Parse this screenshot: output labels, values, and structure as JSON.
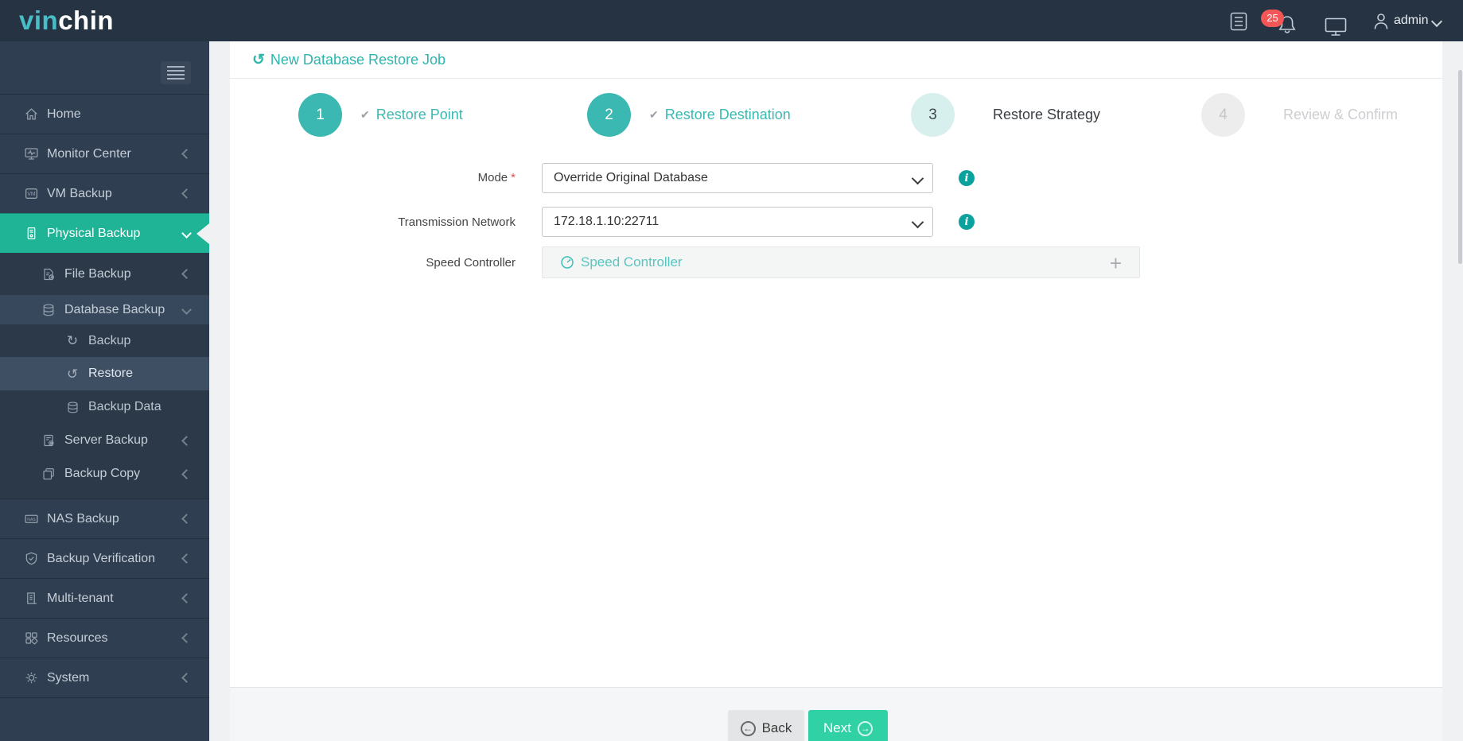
{
  "brand": {
    "accent": "vin",
    "rest": "chin"
  },
  "topbar": {
    "notification_count": "25",
    "username": "admin"
  },
  "sidebar": {
    "items": [
      {
        "label": "Home",
        "icon": "home-icon",
        "chevron": "none",
        "level": "main",
        "active": false
      },
      {
        "label": "Monitor Center",
        "icon": "monitor-center-icon",
        "chevron": "left",
        "level": "main",
        "active": false
      },
      {
        "label": "VM Backup",
        "icon": "vm-backup-icon",
        "chevron": "left",
        "level": "main",
        "active": false
      },
      {
        "label": "Physical Backup",
        "icon": "physical-backup-icon",
        "chevron": "down",
        "level": "main",
        "active": true
      },
      {
        "label": "File Backup",
        "icon": "file-backup-icon",
        "chevron": "left",
        "level": "sub1",
        "active": false
      },
      {
        "label": "Database Backup",
        "icon": "database-icon",
        "chevron": "down",
        "level": "sub1",
        "active": false,
        "expanded": true
      },
      {
        "label": "Backup",
        "icon": "backup-circular-arrow-icon",
        "glyph": "↻",
        "chevron": "none",
        "level": "sub2",
        "active": false
      },
      {
        "label": "Restore",
        "icon": "restore-circular-arrow-icon",
        "glyph": "↺",
        "chevron": "none",
        "level": "sub2",
        "active": false,
        "selected": true
      },
      {
        "label": "Backup Data",
        "icon": "database-icon",
        "chevron": "none",
        "level": "sub2",
        "active": false
      },
      {
        "label": "Server Backup",
        "icon": "server-backup-icon",
        "chevron": "left",
        "level": "sub1",
        "active": false
      },
      {
        "label": "Backup Copy",
        "icon": "backup-copy-icon",
        "chevron": "left",
        "level": "sub1",
        "active": false
      },
      {
        "label": "NAS Backup",
        "icon": "nas-backup-icon",
        "chevron": "left",
        "level": "main",
        "active": false
      },
      {
        "label": "Backup Verification",
        "icon": "shield-check-icon",
        "chevron": "left",
        "level": "main",
        "active": false
      },
      {
        "label": "Multi-tenant",
        "icon": "building-icon",
        "chevron": "left",
        "level": "main",
        "active": false
      },
      {
        "label": "Resources",
        "icon": "grid-icon",
        "chevron": "left",
        "level": "main",
        "active": false
      },
      {
        "label": "System",
        "icon": "gear-icon",
        "chevron": "left",
        "level": "main",
        "active": false
      }
    ]
  },
  "page": {
    "title": "New Database Restore Job",
    "title_icon_glyph": "↺"
  },
  "steps": [
    {
      "number": "1",
      "label": "Restore Point",
      "state": "done",
      "check_glyph": "✔"
    },
    {
      "number": "2",
      "label": "Restore Destination",
      "state": "done",
      "check_glyph": "✔"
    },
    {
      "number": "3",
      "label": "Restore Strategy",
      "state": "current"
    },
    {
      "number": "4",
      "label": "Review & Confirm",
      "state": "upcoming"
    }
  ],
  "form": {
    "info_glyph": "i",
    "mode": {
      "label": "Mode",
      "required_marker": "*",
      "value": "Override Original Database"
    },
    "transmission_network": {
      "label": "Transmission Network",
      "value": "172.18.1.10:22711"
    },
    "speed_controller": {
      "label": "Speed Controller",
      "placeholder": "Speed Controller",
      "add_symbol": "+"
    }
  },
  "footer": {
    "back_label": "Back",
    "back_arrow": "←",
    "next_label": "Next",
    "next_arrow": "→"
  },
  "colors": {
    "topbar_bg": "#263342",
    "sidebar_bg": "#2f3e50",
    "active_green": "#1fb496",
    "accent_teal": "#2cb5ad",
    "step_teal": "#3cb8b2",
    "info_teal": "#0ba29e",
    "next_green": "#30d1a4",
    "badge_red": "#f25656"
  }
}
